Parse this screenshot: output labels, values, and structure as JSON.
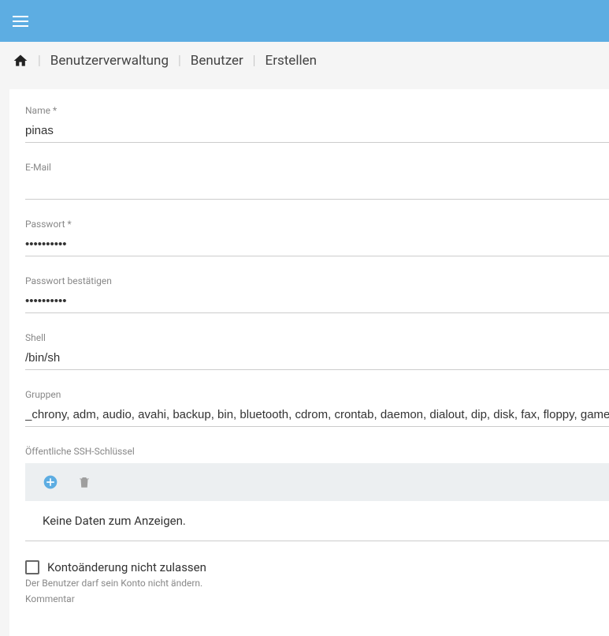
{
  "breadcrumb": {
    "items": [
      "Benutzerverwaltung",
      "Benutzer",
      "Erstellen"
    ]
  },
  "form": {
    "name": {
      "label": "Name *",
      "value": "pinas"
    },
    "email": {
      "label": "E-Mail",
      "value": ""
    },
    "password": {
      "label": "Passwort *",
      "value": "••••••••••"
    },
    "password_confirm": {
      "label": "Passwort bestätigen",
      "value": "••••••••••"
    },
    "shell": {
      "label": "Shell",
      "value": "/bin/sh"
    },
    "groups": {
      "label": "Gruppen",
      "value": "_chrony, adm, audio, avahi, backup, bin, bluetooth, cdrom, crontab, daemon, dialout, dip, disk, fax, floppy, games"
    },
    "ssh": {
      "label": "Öffentliche SSH-Schlüssel",
      "empty_text": "Keine Daten zum Anzeigen."
    },
    "disallow_change": {
      "label": "Kontoänderung nicht zulassen",
      "helper": "Der Benutzer darf sein Konto nicht ändern."
    },
    "comment": {
      "label": "Kommentar"
    }
  },
  "icons": {
    "add": "plus-circle-icon",
    "delete": "trash-icon",
    "home": "home-icon",
    "menu": "hamburger-icon"
  },
  "colors": {
    "topbar": "#5dade2",
    "add_icon": "#5dade2",
    "delete_icon": "#9e9e9e"
  }
}
